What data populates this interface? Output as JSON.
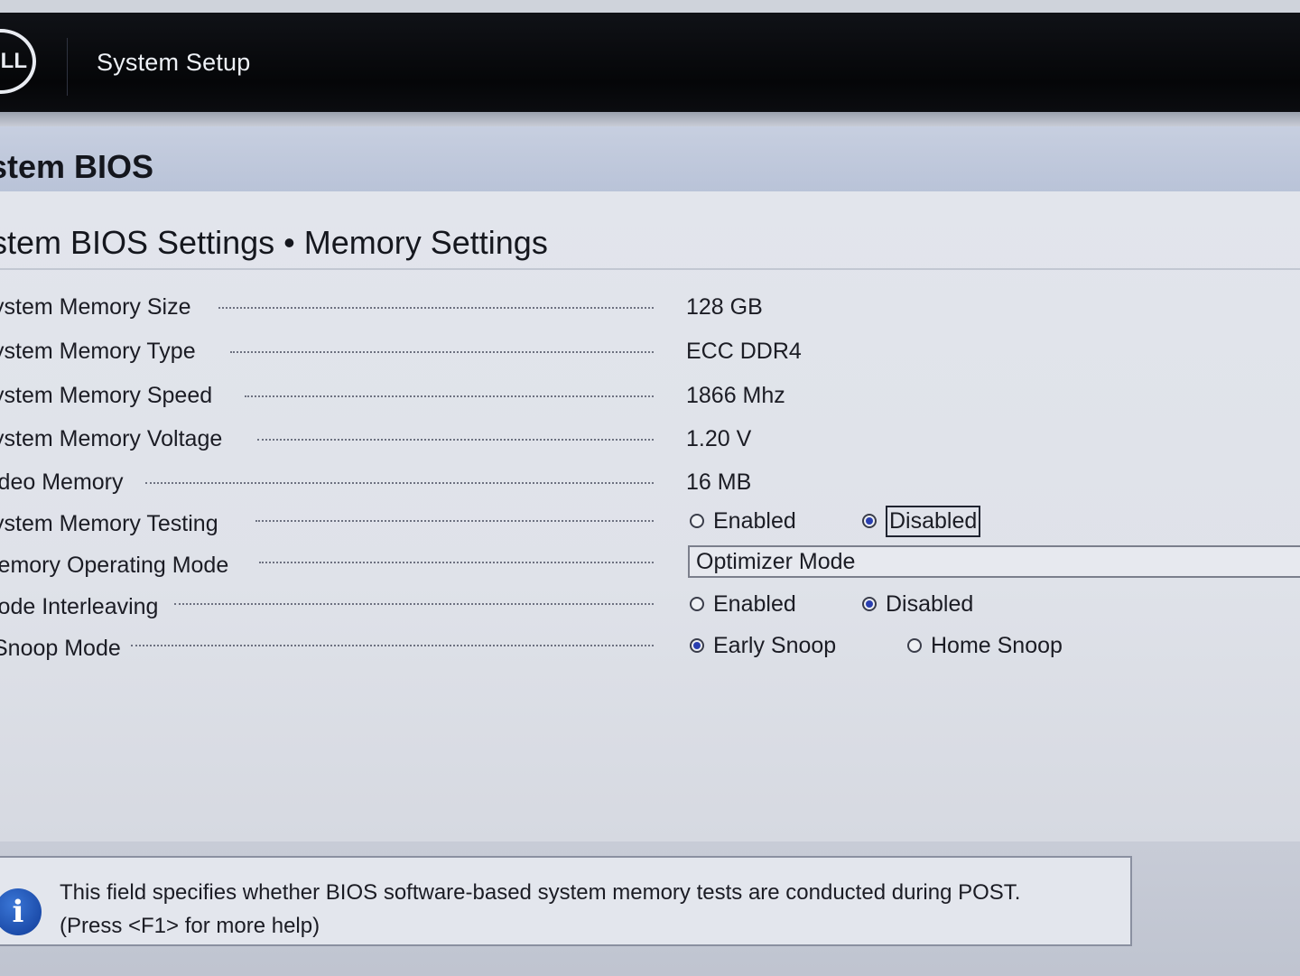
{
  "header": {
    "logo_text": "LL",
    "app_title": "System Setup"
  },
  "section": {
    "title": "stem BIOS"
  },
  "breadcrumb": "stem BIOS Settings • Memory Settings",
  "settings": [
    {
      "label": "ystem Memory Size",
      "value": "128 GB"
    },
    {
      "label": "ystem Memory Type",
      "value": "ECC DDR4"
    },
    {
      "label": "ystem Memory Speed",
      "value": "1866 Mhz"
    },
    {
      "label": "ystem Memory Voltage",
      "value": "1.20 V"
    },
    {
      "label": "ideo Memory",
      "value": "16 MB"
    },
    {
      "label": "ystem Memory Testing",
      "options": [
        "Enabled",
        "Disabled"
      ],
      "selected": "Disabled"
    },
    {
      "label": "lemory Operating Mode",
      "dropdown_value": "Optimizer Mode"
    },
    {
      "label": "lode Interleaving",
      "options": [
        "Enabled",
        "Disabled"
      ],
      "selected": "Disabled"
    },
    {
      "label": "Snoop Mode",
      "options": [
        "Early Snoop",
        "Home Snoop"
      ],
      "selected": "Early Snoop"
    }
  ],
  "help": {
    "line1": "This field specifies whether BIOS software-based system memory tests are conducted during POST.",
    "line2": "(Press <F1> for more help)"
  },
  "icons": {
    "brand": "dell-logo-icon",
    "info": "info-icon"
  },
  "colors": {
    "topbar": "#050608",
    "section_header": "#c0c9dc",
    "radio_selected": "#2a3fb0"
  }
}
